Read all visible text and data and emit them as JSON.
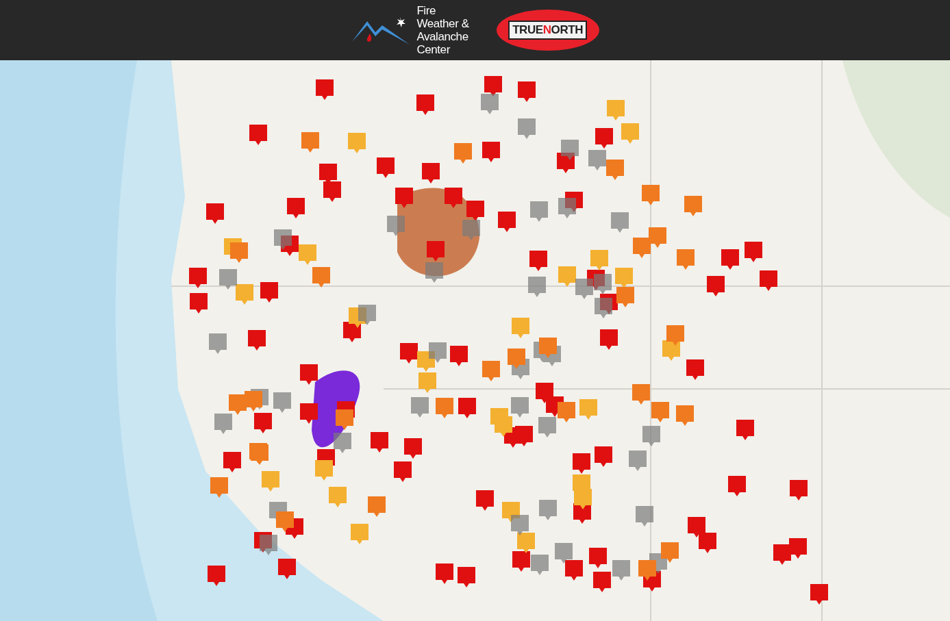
{
  "header": {
    "logo_text_lines": [
      "Fire",
      "Weather &",
      "Avalanche",
      "Center"
    ],
    "brand_parts": [
      {
        "text": "TRUE",
        "highlighted": false
      },
      {
        "text": "N",
        "highlighted": true
      },
      {
        "text": "ORTH",
        "highlighted": false
      }
    ]
  }
}
